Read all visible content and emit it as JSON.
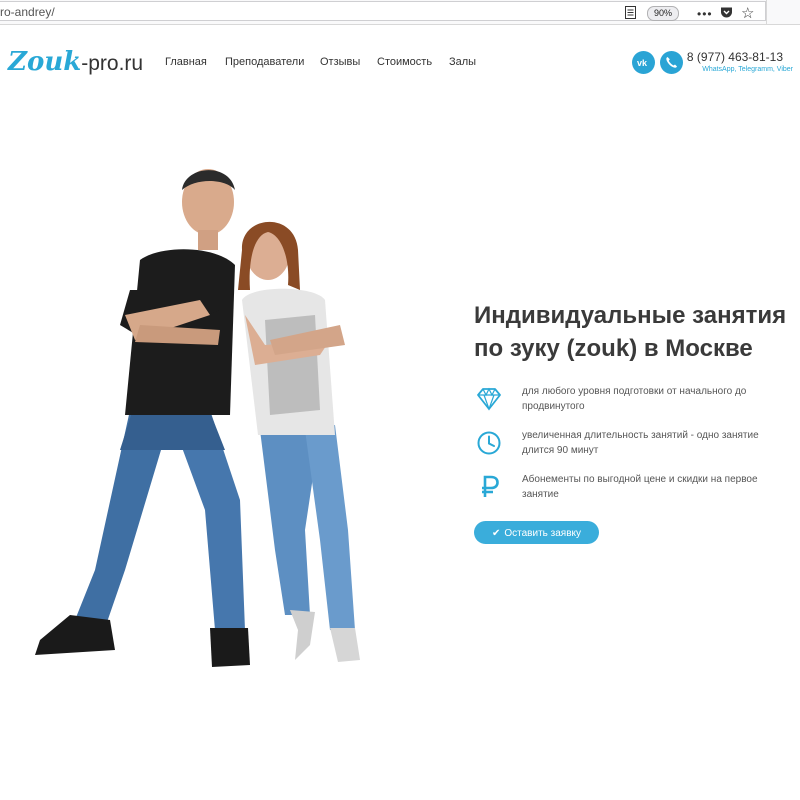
{
  "browser": {
    "url": "ro-andrey/",
    "zoom": "90%",
    "icons": [
      "reader-view-icon",
      "more-icon",
      "pocket-icon",
      "bookmark-star-icon"
    ]
  },
  "header": {
    "logo_accent": "Zouk",
    "logo_rest": "-pro.ru",
    "nav": [
      "Главная",
      "Преподаватели",
      "Отзывы",
      "Стоимость",
      "Залы"
    ],
    "phone": "8 (977) 463-81-13",
    "messengers": "WhatsApp, Telegramm, Viber",
    "social_icons": [
      "vk-icon",
      "phone-icon"
    ]
  },
  "hero": {
    "title": "Индивидуальные занятия по зуку (zouk) в Москве",
    "features": [
      {
        "icon": "diamond-icon",
        "text": "для любого уровня подготовки от начального до продвинутого"
      },
      {
        "icon": "clock-icon",
        "text": "увеличенная длительность занятий - одно занятие длится 90 минут"
      },
      {
        "icon": "ruble-icon",
        "text": "Абонементы по выгодной цене и скидки на первое занятие"
      }
    ],
    "cta": "Оставить заявку"
  },
  "colors": {
    "accent": "#29a8d6",
    "button": "#3aaddb",
    "text": "#333333",
    "background": "#ffffff"
  }
}
